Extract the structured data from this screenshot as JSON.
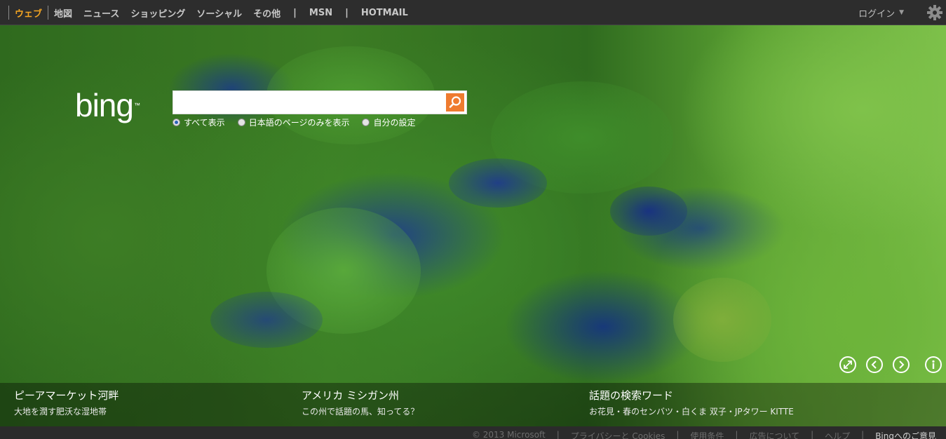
{
  "nav": {
    "items": [
      "ウェブ",
      "地図",
      "ニュース",
      "ショッピング",
      "ソーシャル",
      "その他"
    ],
    "separator": "|",
    "msn": "MSN",
    "hotmail": "HOTMAIL",
    "login": "ログイン"
  },
  "search": {
    "logo": "bing",
    "logo_tm": "™",
    "value": "",
    "filters": [
      "すべて表示",
      "日本語のページのみを表示",
      "自分の設定"
    ],
    "selected_filter": 0
  },
  "hotspots": [
    {
      "title": "ピーアマーケット河畔",
      "subtitle": "大地を潤す肥沃な湿地帯"
    },
    {
      "title": "アメリカ ミシガン州",
      "subtitle": "この州で話題の馬、知ってる？"
    },
    {
      "title": "話題の検索ワード",
      "subtitle": "お花見・春のセンバツ・白くま 双子・JPタワー KITTE"
    }
  ],
  "footer": {
    "copyright": "© 2013 Microsoft",
    "privacy": "プライバシーと Cookies",
    "terms": "使用条件",
    "ads": "広告について",
    "help": "ヘルプ",
    "feedback": "Bingへのご意見",
    "separator": "|"
  },
  "colors": {
    "accent_active_tab": "#f5a623",
    "search_button": "#ef7b2f",
    "topbar": "#2d2d2d"
  },
  "icons": {
    "search": "magnifier-icon",
    "settings": "gear-icon",
    "expand": "expand-icon",
    "prev": "chevron-left-icon",
    "next": "chevron-right-icon",
    "info": "info-icon"
  }
}
